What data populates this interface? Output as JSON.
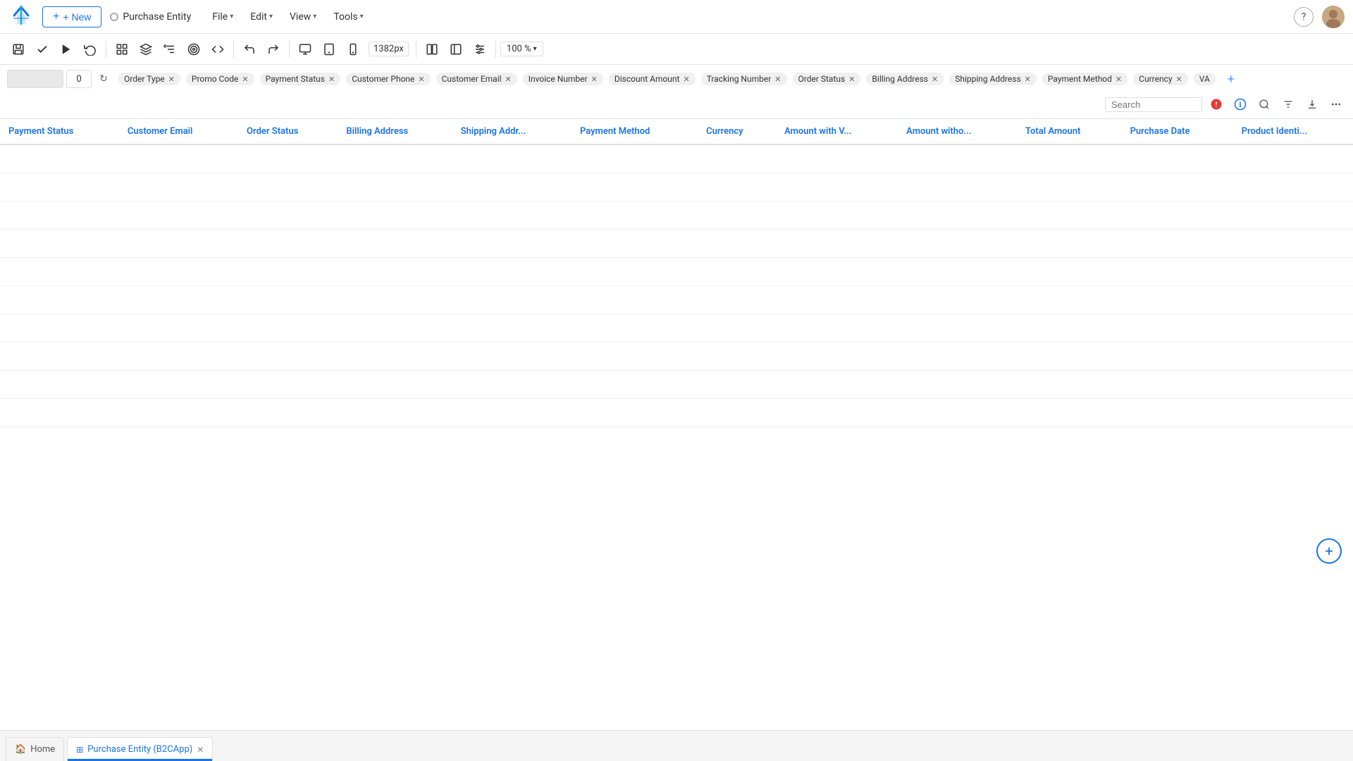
{
  "topbar": {
    "new_label": "+ New",
    "entity_name": "Purchase Entity",
    "menus": [
      {
        "label": "File",
        "id": "file"
      },
      {
        "label": "Edit",
        "id": "edit"
      },
      {
        "label": "View",
        "id": "view"
      },
      {
        "label": "Tools",
        "id": "tools"
      }
    ]
  },
  "toolbar": {
    "px_value": "1382px",
    "zoom_value": "100 %"
  },
  "filterbar": {
    "count_placeholder": "",
    "count_value": "0",
    "search_placeholder": "Search",
    "tags": [
      {
        "label": "Order Type",
        "id": "order-type"
      },
      {
        "label": "Promo Code",
        "id": "promo-code"
      },
      {
        "label": "Payment Status",
        "id": "payment-status"
      },
      {
        "label": "Customer Phone",
        "id": "customer-phone"
      },
      {
        "label": "Customer Email",
        "id": "customer-email"
      },
      {
        "label": "Invoice Number",
        "id": "invoice-number"
      },
      {
        "label": "Discount Amount",
        "id": "discount-amount"
      },
      {
        "label": "Tracking Number",
        "id": "tracking-number"
      },
      {
        "label": "Order Status",
        "id": "order-status"
      },
      {
        "label": "Billing Address",
        "id": "billing-address"
      },
      {
        "label": "Shipping Address",
        "id": "shipping-address"
      },
      {
        "label": "Payment Method",
        "id": "payment-method"
      },
      {
        "label": "Currency",
        "id": "currency"
      },
      {
        "label": "VA",
        "id": "va"
      }
    ]
  },
  "table": {
    "columns": [
      {
        "label": "Payment Status",
        "id": "payment-status"
      },
      {
        "label": "Customer Email",
        "id": "customer-email"
      },
      {
        "label": "Order Status",
        "id": "order-status"
      },
      {
        "label": "Billing Address",
        "id": "billing-address"
      },
      {
        "label": "Shipping Addr...",
        "id": "shipping-addr"
      },
      {
        "label": "Payment Method",
        "id": "payment-method"
      },
      {
        "label": "Currency",
        "id": "currency"
      },
      {
        "label": "Amount with V...",
        "id": "amount-with-v"
      },
      {
        "label": "Amount witho...",
        "id": "amount-witho"
      },
      {
        "label": "Total Amount",
        "id": "total-amount"
      },
      {
        "label": "Purchase Date",
        "id": "purchase-date"
      },
      {
        "label": "Product Identi...",
        "id": "product-identi"
      }
    ],
    "rows": []
  },
  "tabs": [
    {
      "label": "Home",
      "id": "home",
      "icon": "home",
      "active": false,
      "closable": false
    },
    {
      "label": "Purchase Entity (B2CApp)",
      "id": "purchase-entity",
      "icon": "entity",
      "active": true,
      "closable": true
    }
  ]
}
